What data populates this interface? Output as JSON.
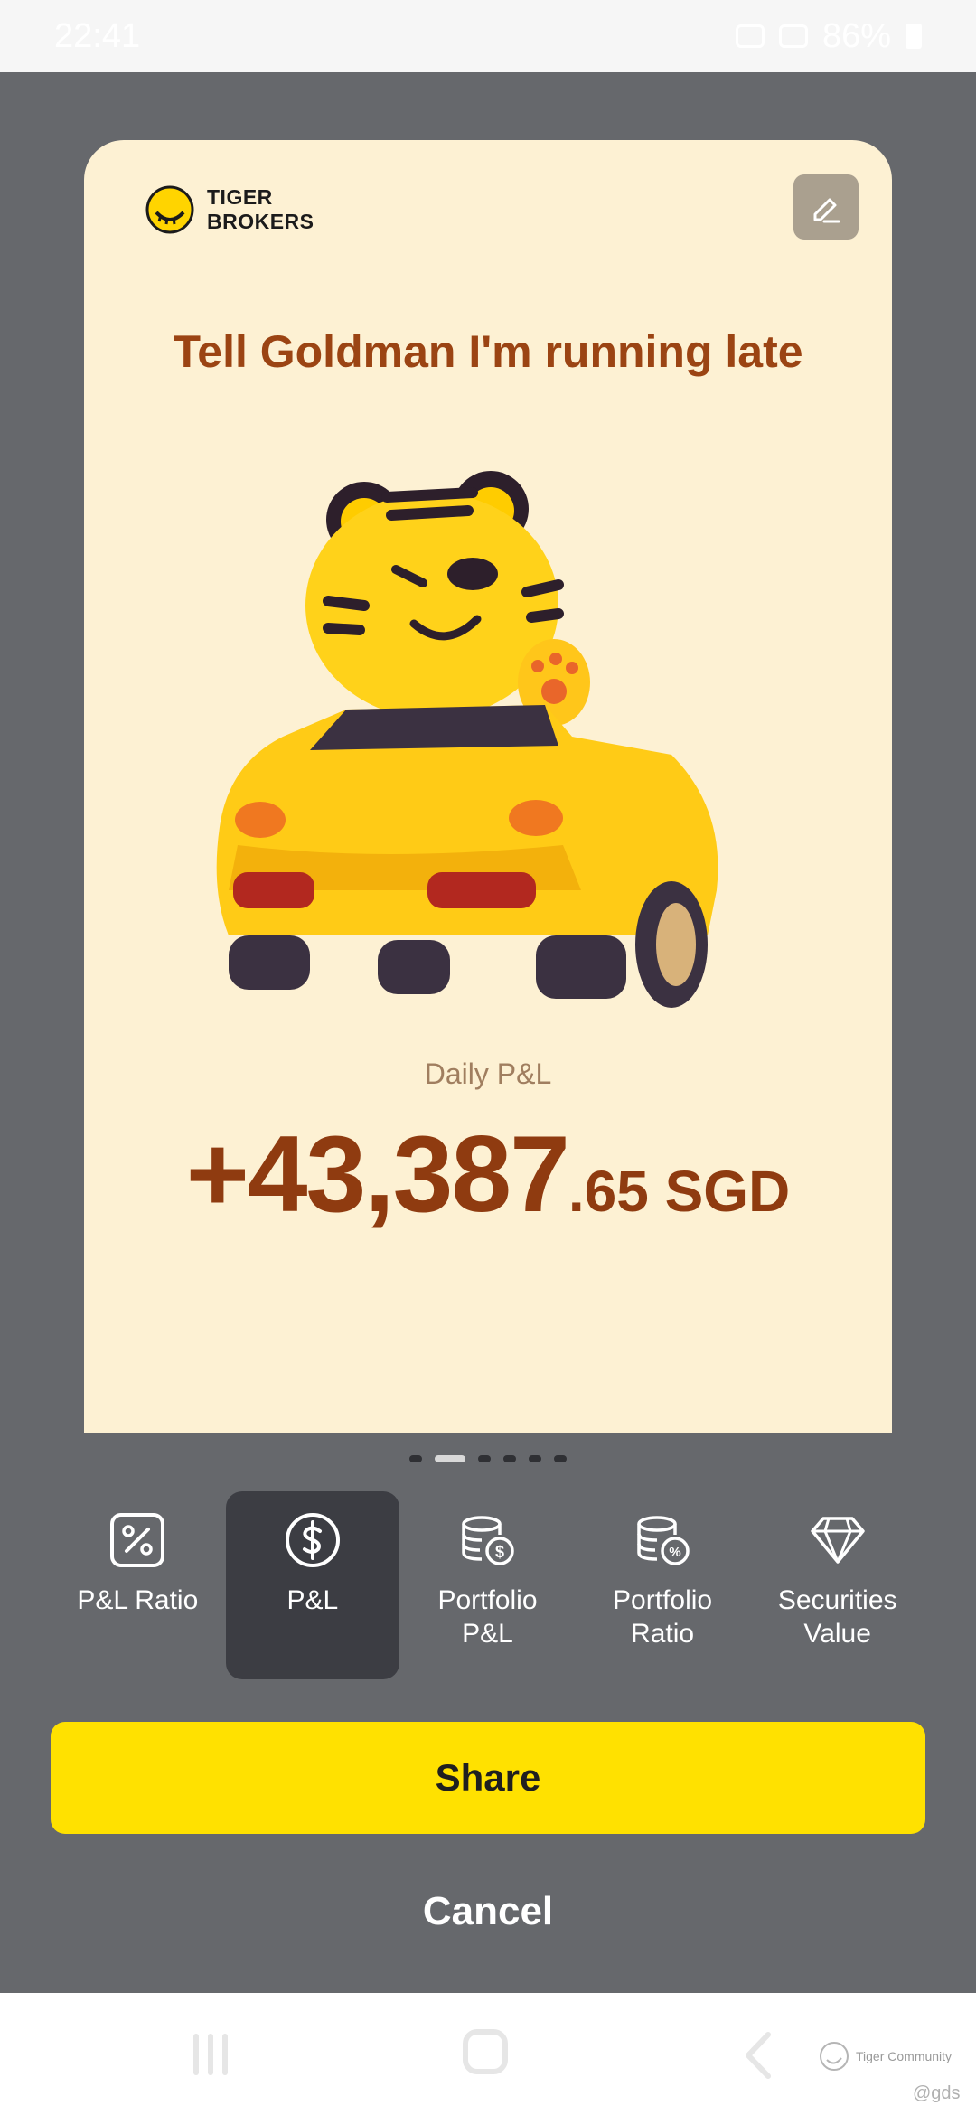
{
  "status_bar": {
    "time": "22:41",
    "battery": "86%"
  },
  "card": {
    "brand_line1": "TIGER",
    "brand_line2": "BROKERS",
    "title": "Tell Goldman I'm running late",
    "metric_label": "Daily P&L",
    "value_integer": "+43,387",
    "value_decimal": ".65 SGD",
    "icons": {
      "logo": "tiger-logo-icon",
      "edit": "edit-pencil-icon",
      "illustration": "tiger-in-yellow-car"
    }
  },
  "pager": {
    "count": 6,
    "active_index": 1
  },
  "tabs": [
    {
      "label": "P&L Ratio",
      "icon": "percent-square-icon",
      "selected": false
    },
    {
      "label": "P&L",
      "icon": "dollar-circle-icon",
      "selected": true
    },
    {
      "label": "Portfolio\nP&L",
      "icon": "coins-dollar-icon",
      "selected": false
    },
    {
      "label": "Portfolio\nRatio",
      "icon": "coins-percent-icon",
      "selected": false
    },
    {
      "label": "Securities\nValue",
      "icon": "diamond-icon",
      "selected": false
    }
  ],
  "actions": {
    "share": "Share",
    "cancel": "Cancel"
  },
  "watermark": {
    "brand": "Tiger Community",
    "user": "@gds"
  },
  "colors": {
    "accent": "#ffe100",
    "card_bg": "#fdf1d3",
    "value_text": "#8f3b10",
    "overlay": "#66686c"
  }
}
